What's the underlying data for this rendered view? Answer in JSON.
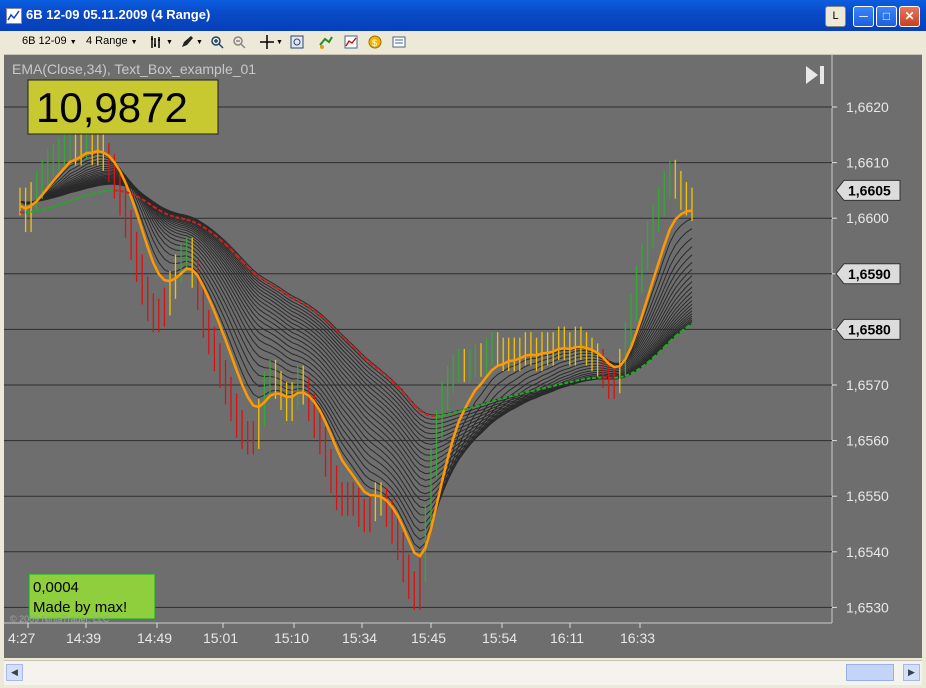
{
  "window": {
    "title": "6B 12-09  05.11.2009 (4 Range)",
    "btn_l": "L"
  },
  "toolbar": {
    "instrument": "6B 12-09",
    "period": "4 Range"
  },
  "indicator_label": "EMA(Close,34), Text_Box_example_01",
  "value_box": "10,9872",
  "note_box": {
    "line1": "0,0004",
    "line2": "Made by max!"
  },
  "copyright": "© 2009 NinjaTrader, LLC",
  "colors": {
    "background": "#6e6e6e",
    "bull": "#33aa33",
    "bear": "#dd1111",
    "neutral": "#f2c500",
    "ema_main": "#ff9900",
    "value_box_bg": "#c8c830",
    "note_box_bg": "#8fce3c"
  },
  "chart_data": {
    "type": "line",
    "y_ticks": [
      "1,6620",
      "1,6610",
      "1,6600",
      "1,6590",
      "1,6580",
      "1,6570",
      "1,6560",
      "1,6550",
      "1,6540",
      "1,6530"
    ],
    "ylim": [
      1.6528,
      1.6626
    ],
    "x_ticks": [
      "4:27",
      "14:39",
      "14:49",
      "15:01",
      "15:10",
      "15:34",
      "15:45",
      "15:54",
      "16:11",
      "16:33"
    ],
    "price_markers": [
      "1,6605",
      "1,6590",
      "1,6580"
    ],
    "bar_count": 122,
    "close": [
      1.6603,
      1.66,
      1.6604,
      1.6606,
      1.6608,
      1.661,
      1.6611,
      1.6612,
      1.6613,
      1.6614,
      1.6612,
      1.6613,
      1.6614,
      1.6612,
      1.6613,
      1.6611,
      1.6609,
      1.6606,
      1.6603,
      1.6599,
      1.6595,
      1.6591,
      1.6587,
      1.6584,
      1.6582,
      1.6583,
      1.6585,
      1.6588,
      1.6591,
      1.6593,
      1.6594,
      1.659,
      1.6586,
      1.6581,
      1.6578,
      1.6575,
      1.6572,
      1.6569,
      1.6566,
      1.6563,
      1.6561,
      1.656,
      1.6561,
      1.6565,
      1.657,
      1.6572,
      1.657,
      1.6568,
      1.6566,
      1.6568,
      1.6571,
      1.6569,
      1.6566,
      1.6563,
      1.656,
      1.6556,
      1.6553,
      1.655,
      1.6549,
      1.655,
      1.6549,
      1.6547,
      1.6546,
      1.6548,
      1.655,
      1.6549,
      1.6547,
      1.6544,
      1.6541,
      1.6537,
      1.6534,
      1.6532,
      1.6537,
      1.6546,
      1.6556,
      1.6563,
      1.6568,
      1.6571,
      1.6573,
      1.6574,
      1.6573,
      1.6574,
      1.6575,
      1.6574,
      1.6576,
      1.6577,
      1.6576,
      1.6575,
      1.6576,
      1.6575,
      1.6576,
      1.6577,
      1.6576,
      1.6575,
      1.6577,
      1.6576,
      1.6577,
      1.6578,
      1.6577,
      1.6576,
      1.6578,
      1.6577,
      1.6576,
      1.6575,
      1.6574,
      1.6572,
      1.657,
      1.6571,
      1.6574,
      1.6579,
      1.6584,
      1.6589,
      1.6593,
      1.6597,
      1.66,
      1.6603,
      1.6606,
      1.6608,
      1.6606,
      1.6604,
      1.6603,
      1.6602
    ],
    "ema_fast": {
      "name": "EMA",
      "start": 1.6602,
      "period": 8
    },
    "ribbon": {
      "count": 22,
      "min_period": 10,
      "max_period": 60
    },
    "ema_slow_start": 1.6601
  }
}
